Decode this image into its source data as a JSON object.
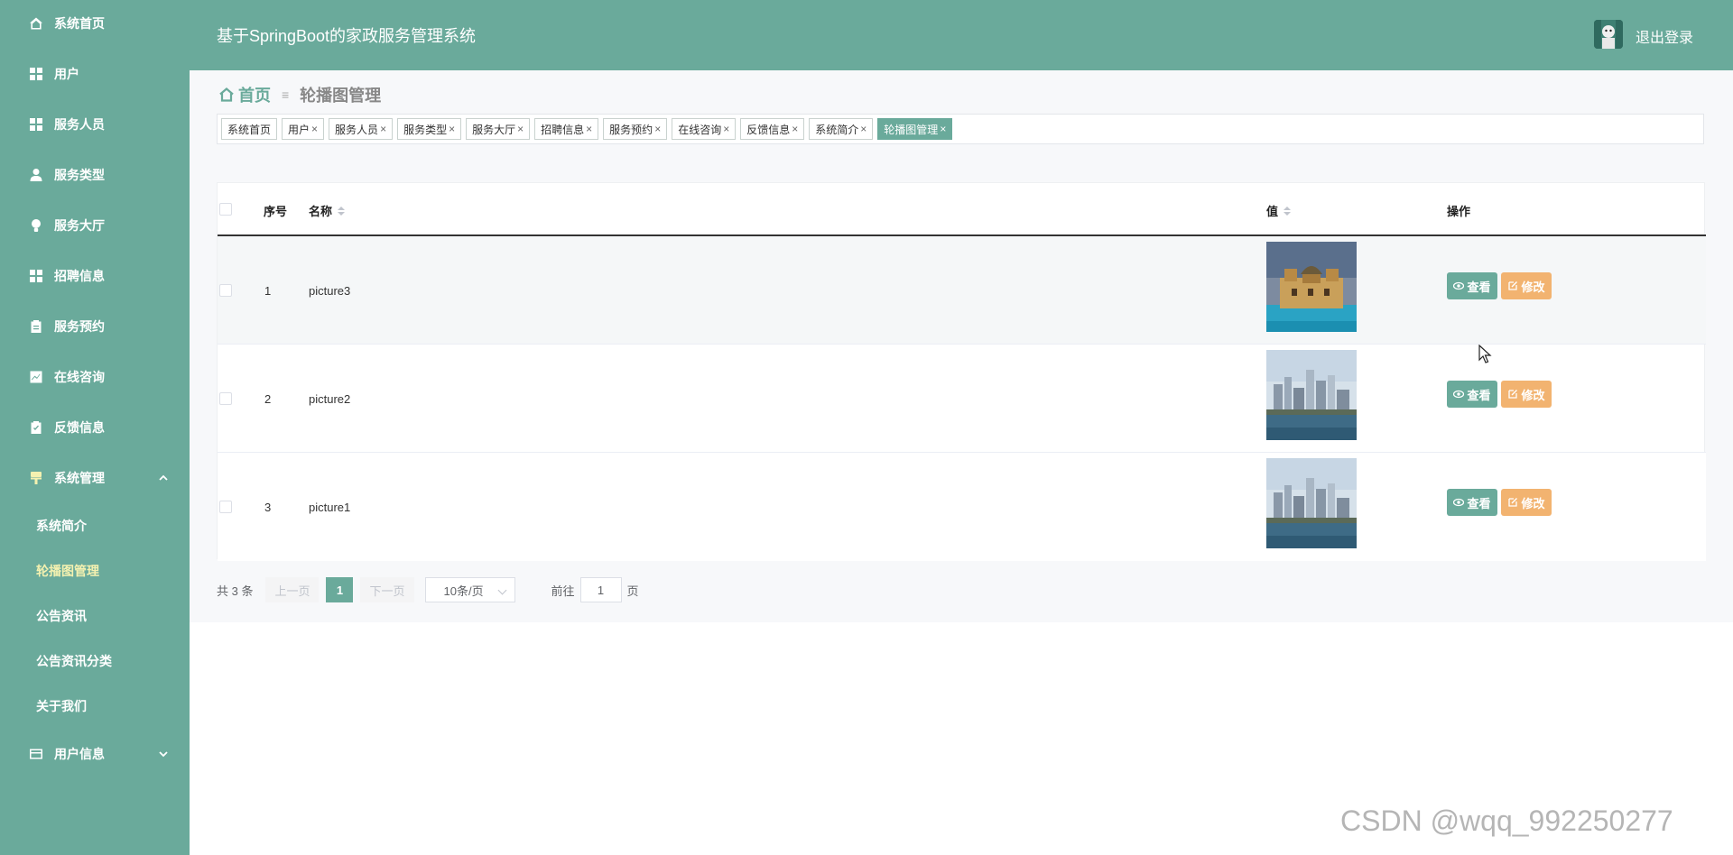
{
  "app": {
    "title": "基于SpringBoot的家政服务管理系统",
    "logout_label": "退出登录"
  },
  "colors": {
    "primary": "#6aaa9b",
    "warning": "#f2b370",
    "active_submenu": "#f4f1b0"
  },
  "sidebar": {
    "items": [
      {
        "label": "系统首页",
        "icon": "home-icon"
      },
      {
        "label": "用户",
        "icon": "grid-icon"
      },
      {
        "label": "服务人员",
        "icon": "grid-icon"
      },
      {
        "label": "服务类型",
        "icon": "user-icon"
      },
      {
        "label": "服务大厅",
        "icon": "bulb-icon"
      },
      {
        "label": "招聘信息",
        "icon": "grid-icon"
      },
      {
        "label": "服务预约",
        "icon": "clipboard-icon"
      },
      {
        "label": "在线咨询",
        "icon": "chart-icon"
      },
      {
        "label": "反馈信息",
        "icon": "clipboard-check-icon"
      },
      {
        "label": "系统管理",
        "icon": "brush-icon"
      },
      {
        "label": "用户信息",
        "icon": "card-icon"
      }
    ],
    "submenu": [
      {
        "label": "系统简介"
      },
      {
        "label": "轮播图管理"
      },
      {
        "label": "公告资讯"
      },
      {
        "label": "公告资讯分类"
      },
      {
        "label": "关于我们"
      }
    ]
  },
  "breadcrumb": {
    "home": "首页",
    "separator": "≡",
    "current": "轮播图管理"
  },
  "tags": [
    {
      "label": "系统首页",
      "closable": false
    },
    {
      "label": "用户",
      "closable": true
    },
    {
      "label": "服务人员",
      "closable": true
    },
    {
      "label": "服务类型",
      "closable": true
    },
    {
      "label": "服务大厅",
      "closable": true
    },
    {
      "label": "招聘信息",
      "closable": true
    },
    {
      "label": "服务预约",
      "closable": true
    },
    {
      "label": "在线咨询",
      "closable": true
    },
    {
      "label": "反馈信息",
      "closable": true
    },
    {
      "label": "系统简介",
      "closable": true
    },
    {
      "label": "轮播图管理",
      "closable": true,
      "active": true
    }
  ],
  "tag_close_glyph": "×",
  "table": {
    "headers": {
      "index": "序号",
      "name": "名称",
      "value": "值",
      "actions": "操作"
    },
    "rows": [
      {
        "index": "1",
        "name": "picture3",
        "image": "castle-photo"
      },
      {
        "index": "2",
        "name": "picture2",
        "image": "city-skyline-photo"
      },
      {
        "index": "3",
        "name": "picture1",
        "image": "city-skyline-photo"
      }
    ],
    "view_label": "查看",
    "edit_label": "修改"
  },
  "pagination": {
    "total": "共 3 条",
    "prev": "上一页",
    "current_page": "1",
    "next": "下一页",
    "page_size": "10条/页",
    "goto_label": "前往",
    "goto_value": "1",
    "page_unit": "页"
  },
  "watermark": "CSDN @wqq_992250277"
}
